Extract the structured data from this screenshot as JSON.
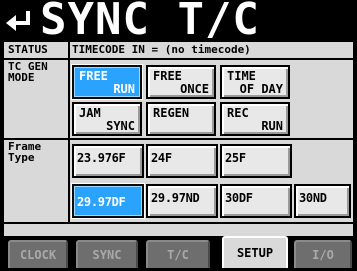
{
  "header": {
    "title": "SYNC T/C",
    "back_icon": "return-arrow-icon"
  },
  "status": {
    "label": "STATUS",
    "value": "TIMECODE IN = (no timecode)"
  },
  "tc_gen_mode": {
    "label_line1": "TC GEN",
    "label_line2": "MODE",
    "buttons": [
      {
        "l1": "FREE",
        "l2": "RUN",
        "selected": true
      },
      {
        "l1": "FREE",
        "l2": "ONCE",
        "selected": false
      },
      {
        "l1": "TIME",
        "l2": "OF DAY",
        "selected": false
      },
      {
        "l1": "JAM",
        "l2": "SYNC",
        "selected": false
      },
      {
        "l1": "REGEN",
        "l2": "",
        "selected": false
      },
      {
        "l1": "REC",
        "l2": "RUN",
        "selected": false
      }
    ]
  },
  "frame_type": {
    "label_line1": "Frame",
    "label_line2": "Type",
    "buttons": [
      {
        "label": "23.976F",
        "selected": false
      },
      {
        "label": "24F",
        "selected": false
      },
      {
        "label": "25F",
        "selected": false
      },
      {
        "label": "29.97DF",
        "selected": true
      },
      {
        "label": "29.97ND",
        "selected": false
      },
      {
        "label": "30DF",
        "selected": false
      },
      {
        "label": "30ND",
        "selected": false
      }
    ]
  },
  "tabs": [
    {
      "label": "CLOCK",
      "active": false
    },
    {
      "label": "SYNC",
      "active": false
    },
    {
      "label": "T/C",
      "active": false
    },
    {
      "label": "SETUP",
      "active": true
    },
    {
      "label": "I/O",
      "active": false
    }
  ],
  "colors": {
    "selected": "#2aa3ff",
    "panel": "#d9d9d9",
    "button": "#e8e8e8",
    "tab_inactive": "#6e6e6e"
  }
}
